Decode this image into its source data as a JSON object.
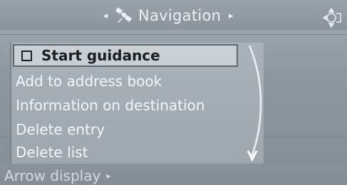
{
  "header": {
    "title": "Navigation",
    "arrow_left": "◂",
    "arrow_right": "▸",
    "title_icon": "satellite-icon",
    "corner_icon": "controller-icon"
  },
  "menu": {
    "items": [
      {
        "label": "Start guidance",
        "selected": true,
        "checkbox": true
      },
      {
        "label": "Add to address book",
        "selected": false
      },
      {
        "label": "Information on destination",
        "selected": false
      },
      {
        "label": "Delete entry",
        "selected": false
      },
      {
        "label": "Delete list",
        "selected": false
      }
    ],
    "scroll_indicator_icon": "scroll-down-arrow-icon"
  },
  "footer": {
    "label": "Arrow display",
    "arrow": "▸"
  },
  "colors": {
    "background": "#8e979f",
    "menu_background": "#a4acb3",
    "selected_background": "#c9cfd3",
    "text_light": "#f4f6f7",
    "text_dark": "#1b1f22"
  }
}
